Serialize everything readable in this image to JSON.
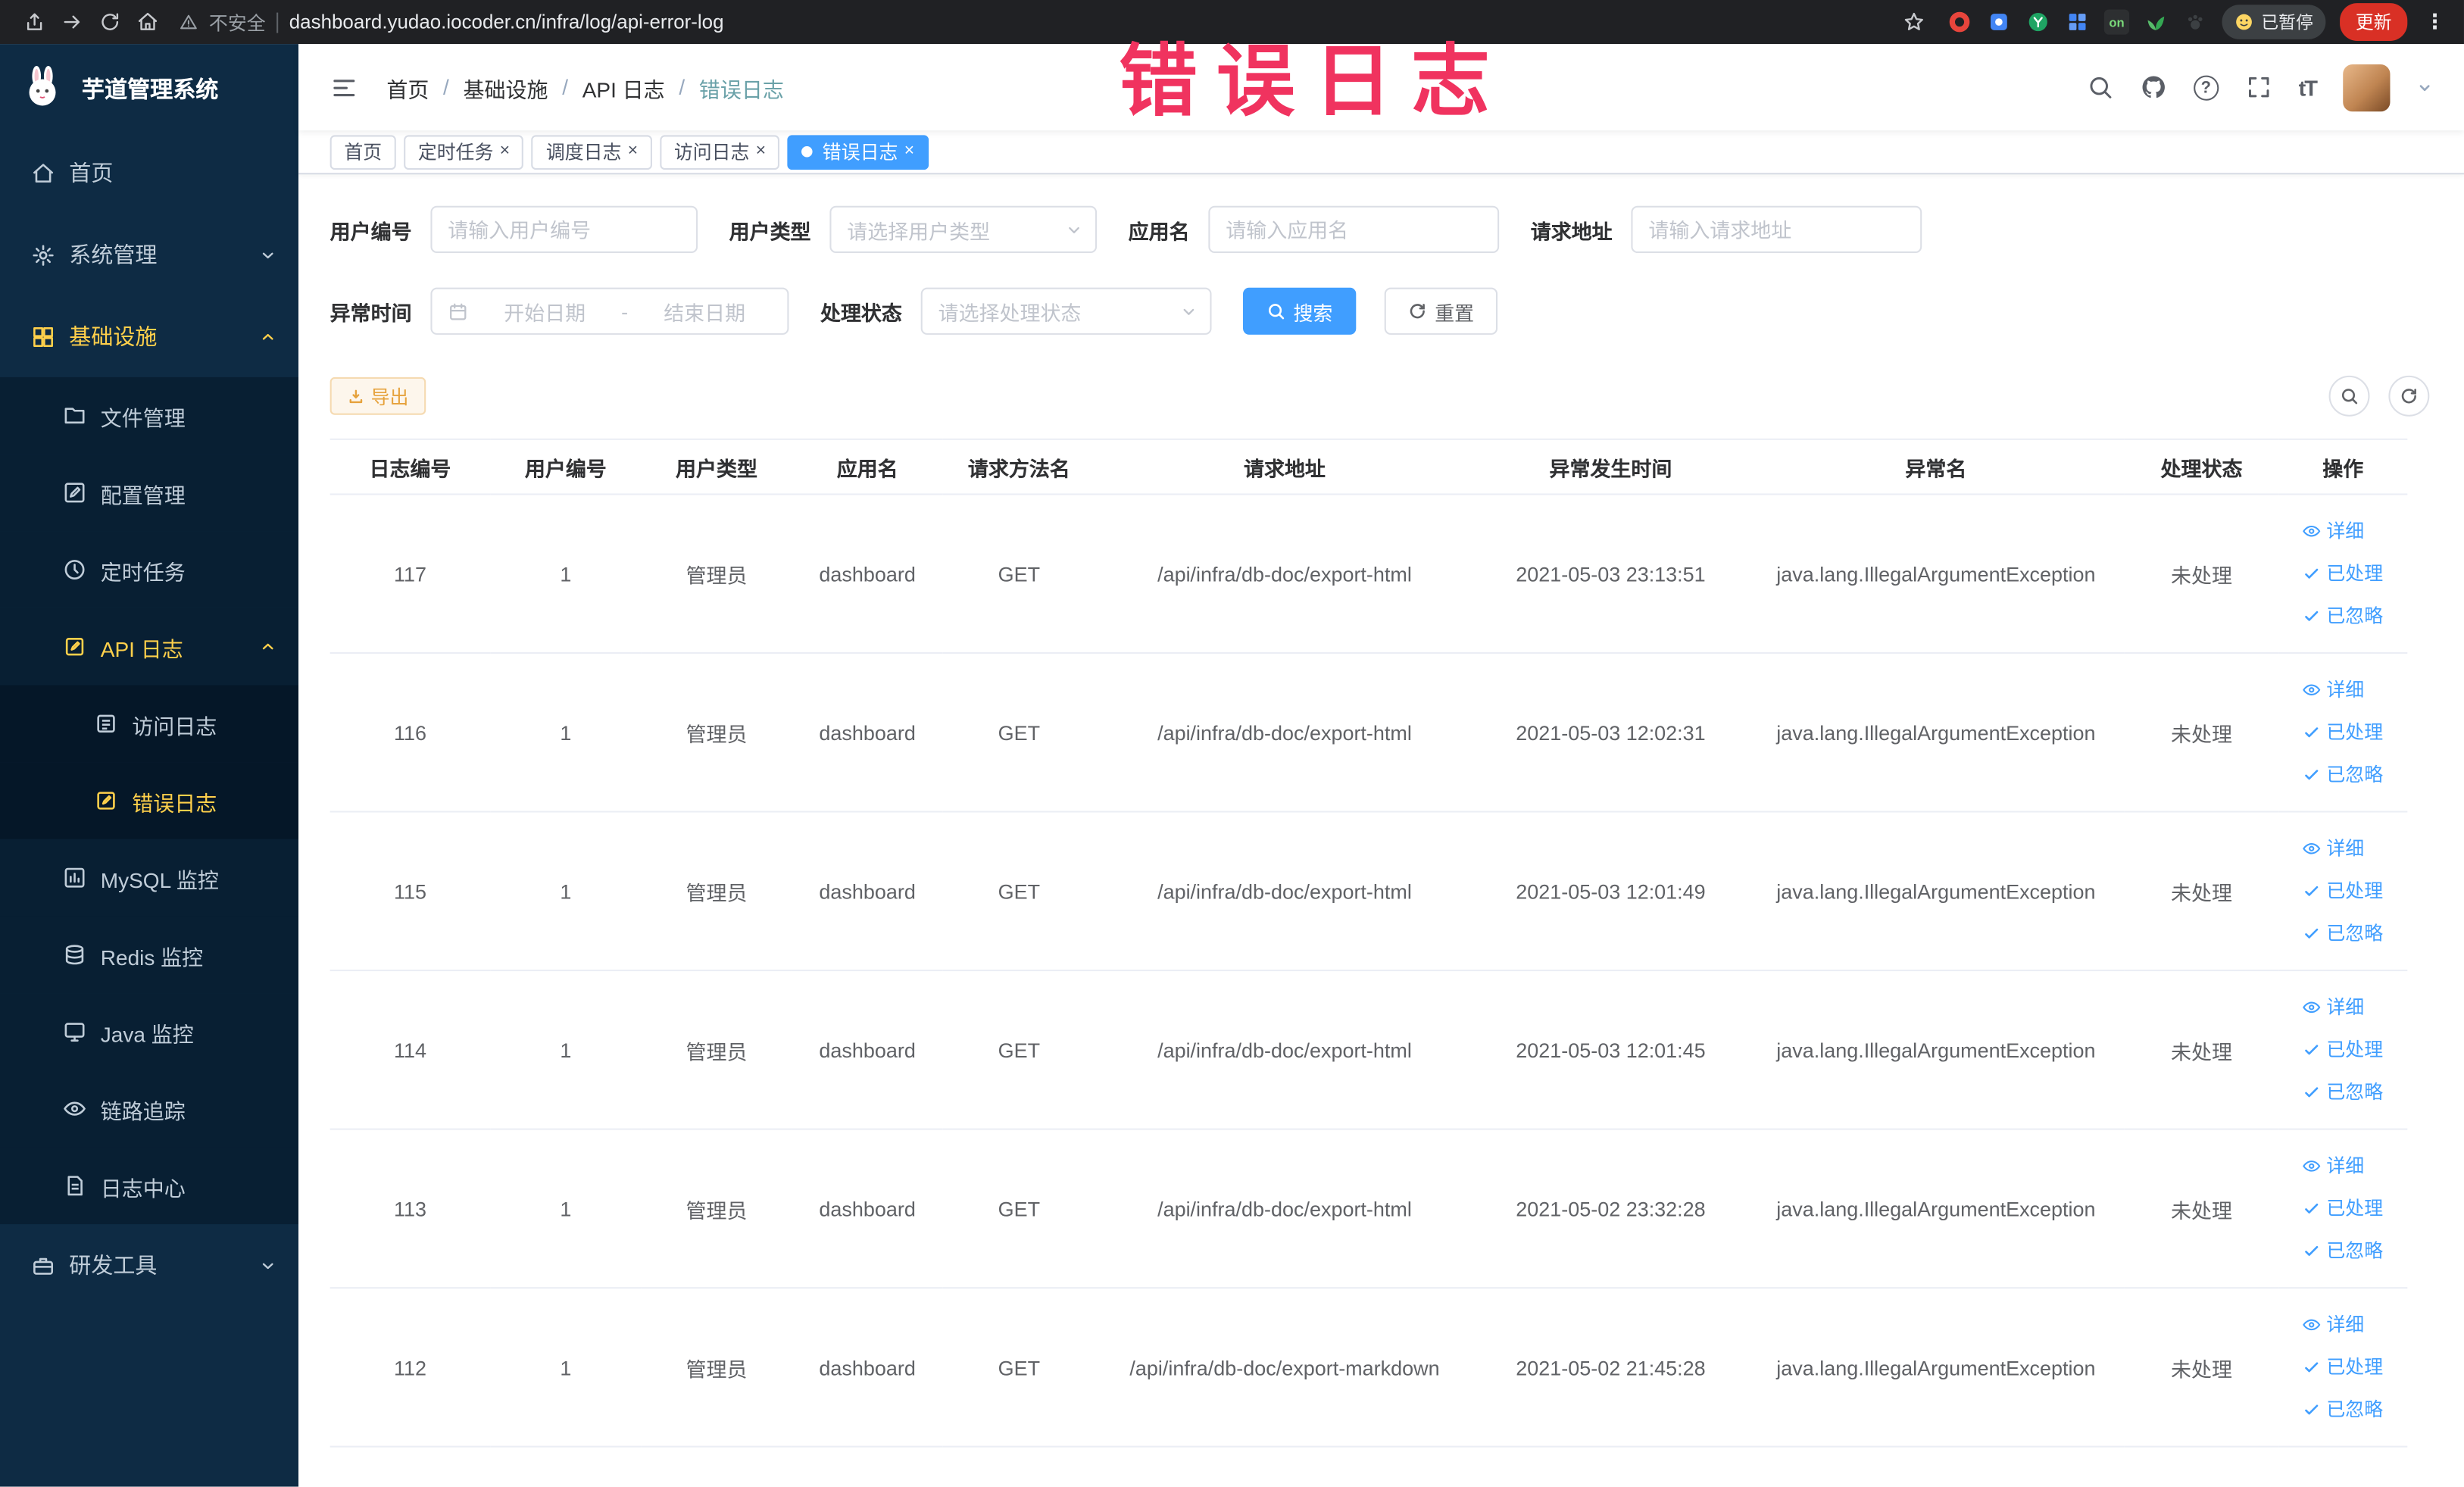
{
  "colors": {
    "accent": "#409eff",
    "sidebar_active": "#ffd04b",
    "warning": "#e6a23c",
    "annotation": "#f0335f",
    "tag_active_bg": "#409eff"
  },
  "glyphs": {
    "close": "×",
    "question": "?",
    "dots": "⋮",
    "font_size": "tT",
    "on": "on",
    "slash": "/"
  },
  "annotation": {
    "text": "错误日志"
  },
  "browser": {
    "security_label": "不安全",
    "url": "dashboard.yudao.iocoder.cn/infra/log/api-error-log",
    "paused_badge": "已暂停",
    "update_button": "更新"
  },
  "sidebar": {
    "logo_title": "芋道管理系统",
    "items": [
      {
        "label": "首页"
      },
      {
        "label": "系统管理"
      },
      {
        "label": "基础设施"
      },
      {
        "label": "文件管理"
      },
      {
        "label": "配置管理"
      },
      {
        "label": "定时任务"
      },
      {
        "label": "API 日志"
      },
      {
        "label": "访问日志"
      },
      {
        "label": "错误日志"
      },
      {
        "label": "MySQL 监控"
      },
      {
        "label": "Redis 监控"
      },
      {
        "label": "Java 监控"
      },
      {
        "label": "链路追踪"
      },
      {
        "label": "日志中心"
      },
      {
        "label": "研发工具"
      }
    ]
  },
  "breadcrumb": {
    "items": [
      "首页",
      "基础设施",
      "API 日志",
      "错误日志"
    ]
  },
  "tabs": [
    {
      "label": "首页"
    },
    {
      "label": "定时任务"
    },
    {
      "label": "调度日志"
    },
    {
      "label": "访问日志"
    },
    {
      "label": "错误日志"
    }
  ],
  "filters": {
    "user_id_label": "用户编号",
    "user_id_placeholder": "请输入用户编号",
    "user_type_label": "用户类型",
    "user_type_placeholder": "请选择用户类型",
    "app_name_label": "应用名",
    "app_name_placeholder": "请输入应用名",
    "request_url_label": "请求地址",
    "request_url_placeholder": "请输入请求地址",
    "exception_time_label": "异常时间",
    "start_date_placeholder": "开始日期",
    "end_date_placeholder": "结束日期",
    "date_separator": "-",
    "process_status_label": "处理状态",
    "process_status_placeholder": "请选择处理状态",
    "search_button": "搜索",
    "reset_button": "重置"
  },
  "toolbar": {
    "export_button": "导出"
  },
  "table": {
    "headers": [
      "日志编号",
      "用户编号",
      "用户类型",
      "应用名",
      "请求方法名",
      "请求地址",
      "异常发生时间",
      "异常名",
      "处理状态",
      "操作"
    ],
    "actions": {
      "detail": "详细",
      "processed": "已处理",
      "ignored": "已忽略"
    },
    "rows": [
      {
        "id": "117",
        "user_id": "1",
        "user_type": "管理员",
        "app": "dashboard",
        "method": "GET",
        "url": "/api/infra/db-doc/export-html",
        "time": "2021-05-03 23:13:51",
        "exception": "java.lang.IllegalArgumentException",
        "status": "未处理"
      },
      {
        "id": "116",
        "user_id": "1",
        "user_type": "管理员",
        "app": "dashboard",
        "method": "GET",
        "url": "/api/infra/db-doc/export-html",
        "time": "2021-05-03 12:02:31",
        "exception": "java.lang.IllegalArgumentException",
        "status": "未处理"
      },
      {
        "id": "115",
        "user_id": "1",
        "user_type": "管理员",
        "app": "dashboard",
        "method": "GET",
        "url": "/api/infra/db-doc/export-html",
        "time": "2021-05-03 12:01:49",
        "exception": "java.lang.IllegalArgumentException",
        "status": "未处理"
      },
      {
        "id": "114",
        "user_id": "1",
        "user_type": "管理员",
        "app": "dashboard",
        "method": "GET",
        "url": "/api/infra/db-doc/export-html",
        "time": "2021-05-03 12:01:45",
        "exception": "java.lang.IllegalArgumentException",
        "status": "未处理"
      },
      {
        "id": "113",
        "user_id": "1",
        "user_type": "管理员",
        "app": "dashboard",
        "method": "GET",
        "url": "/api/infra/db-doc/export-html",
        "time": "2021-05-02 23:32:28",
        "exception": "java.lang.IllegalArgumentException",
        "status": "未处理"
      },
      {
        "id": "112",
        "user_id": "1",
        "user_type": "管理员",
        "app": "dashboard",
        "method": "GET",
        "url": "/api/infra/db-doc/export-markdown",
        "time": "2021-05-02 21:45:28",
        "exception": "java.lang.IllegalArgumentException",
        "status": "未处理"
      }
    ]
  }
}
